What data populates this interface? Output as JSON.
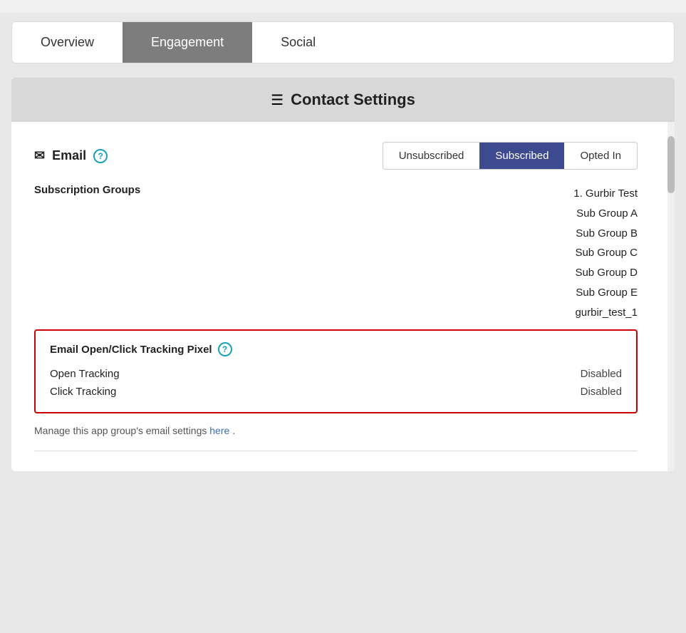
{
  "tabs": [
    {
      "id": "overview",
      "label": "Overview",
      "active": false
    },
    {
      "id": "engagement",
      "label": "Engagement",
      "active": true
    },
    {
      "id": "social",
      "label": "Social",
      "active": false
    }
  ],
  "contactSettings": {
    "icon": "☰",
    "title": "Contact Settings"
  },
  "email": {
    "label": "Email",
    "icon": "✉",
    "help": "?",
    "subscriptionButtons": [
      {
        "label": "Unsubscribed",
        "active": false
      },
      {
        "label": "Subscribed",
        "active": true
      },
      {
        "label": "Opted In",
        "active": false
      }
    ]
  },
  "subscriptionGroups": {
    "label": "Subscription Groups",
    "groups": [
      "1. Gurbir Test",
      "Sub Group A",
      "Sub Group B",
      "Sub Group C",
      "Sub Group D",
      "Sub Group E",
      "gurbir_test_1"
    ]
  },
  "tracking": {
    "title": "Email Open/Click Tracking Pixel",
    "help": "?",
    "rows": [
      {
        "label": "Open Tracking",
        "status": "Disabled"
      },
      {
        "label": "Click Tracking",
        "status": "Disabled"
      }
    ]
  },
  "footer": {
    "text": "Manage this app group's email settings",
    "linkText": "here",
    "suffix": "."
  }
}
